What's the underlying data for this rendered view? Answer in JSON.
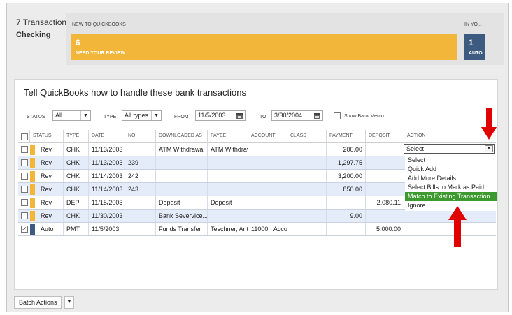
{
  "header": {
    "transactions_title": "7 Transactions",
    "account": "Checking",
    "new_label": "NEW TO QUICKBOOKS",
    "in_label": "IN YO...",
    "review_count": "6",
    "review_label": "NEED YOUR REVIEW",
    "auto_count": "1",
    "auto_label": "AUTO"
  },
  "main": {
    "title": "Tell QuickBooks how to handle these bank transactions"
  },
  "filters": {
    "status_label": "STATUS",
    "status_value": "All",
    "type_label": "TYPE",
    "type_value": "All types",
    "from_label": "FROM",
    "from_value": "11/5/2003",
    "to_label": "TO",
    "to_value": "3/30/2004",
    "memo_label": "Show Bank Memo"
  },
  "columns": [
    "STATUS",
    "TYPE",
    "DATE",
    "NO.",
    "DOWNLOADED AS",
    "PAYEE",
    "ACCOUNT",
    "CLASS",
    "PAYMENT",
    "DEPOSIT",
    "ACTION"
  ],
  "rows": [
    {
      "checked": "",
      "status": "Rev",
      "type": "CHK",
      "date": "11/13/2003",
      "no": "",
      "downloaded": "ATM Withdrawal",
      "payee": "ATM Withdrav",
      "account": "",
      "class": "",
      "payment": "200.00",
      "deposit": "",
      "action": "",
      "status_color": "#f2b63a"
    },
    {
      "checked": "",
      "status": "Rev",
      "type": "CHK",
      "date": "11/13/2003",
      "no": "239",
      "downloaded": "",
      "payee": "",
      "account": "",
      "class": "",
      "payment": "1,297.75",
      "deposit": "",
      "action": "",
      "status_color": "#f2b63a"
    },
    {
      "checked": "",
      "status": "Rev",
      "type": "CHK",
      "date": "11/14/2003",
      "no": "242",
      "downloaded": "",
      "payee": "",
      "account": "",
      "class": "",
      "payment": "3,200.00",
      "deposit": "",
      "action": "",
      "status_color": "#f2b63a"
    },
    {
      "checked": "",
      "status": "Rev",
      "type": "CHK",
      "date": "11/14/2003",
      "no": "243",
      "downloaded": "",
      "payee": "",
      "account": "",
      "class": "",
      "payment": "850.00",
      "deposit": "",
      "action": "",
      "status_color": "#f2b63a"
    },
    {
      "checked": "",
      "status": "Rev",
      "type": "DEP",
      "date": "11/15/2003",
      "no": "",
      "downloaded": "Deposit",
      "payee": "Deposit",
      "account": "",
      "class": "",
      "payment": "",
      "deposit": "2,080.11",
      "action": "",
      "status_color": "#f2b63a"
    },
    {
      "checked": "",
      "status": "Rev",
      "type": "CHK",
      "date": "11/30/2003",
      "no": "",
      "downloaded": "Bank Severvice...",
      "payee": "",
      "account": "",
      "class": "",
      "payment": "9.00",
      "deposit": "",
      "action": "",
      "status_color": "#f2b63a"
    },
    {
      "checked": "✓",
      "status": "Auto",
      "type": "PMT",
      "date": "11/5/2003",
      "no": "",
      "downloaded": "Funds Transfer",
      "payee": "Teschner, Ant",
      "account": "11000 · Accou",
      "class": "",
      "payment": "",
      "deposit": "5,000.00",
      "action": "",
      "status_color": "#3d5a80"
    }
  ],
  "action": {
    "selected": "Select",
    "options": [
      "Select",
      "Quick Add",
      "Add More Details",
      "Select Bills to Mark as Paid",
      "Match to Existing Transaction",
      "Ignore"
    ],
    "highlighted": "Match to Existing Transaction"
  },
  "batch": {
    "label": "Batch Actions"
  },
  "colors": {
    "review": "#f2b63a",
    "auto": "#3d5a80",
    "highlight": "#3d9a2f",
    "annotation_arrow": "#e00000"
  }
}
